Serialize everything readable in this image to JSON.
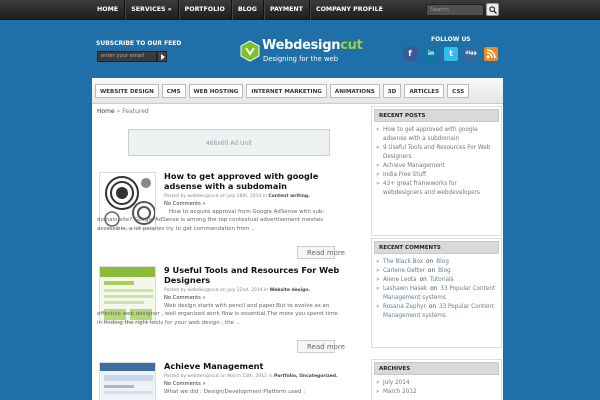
{
  "topnav": {
    "items": [
      "HOME",
      "SERVICES",
      "PORTFOLIO",
      "BLOG",
      "PAYMENT",
      "COMPANY PROFILE"
    ],
    "services_arrow": "»",
    "search_placeholder": "Search"
  },
  "header": {
    "subscribe_title": "SUBSCRIBE TO OUR FEED",
    "email_placeholder": "enter your email",
    "logo_main": "Webdesign",
    "logo_accent": "cut",
    "logo_sub": "Designing for the web",
    "follow_title": "FOLLOW US"
  },
  "categories": [
    "WEBSITE DESIGN",
    "CMS",
    "WEB HOSTING",
    "INTERNET MARKETING",
    "ANIMATIONS",
    "3D",
    "ARTICLES",
    "CSS"
  ],
  "breadcrumb": {
    "home": "Home",
    "sep": "»",
    "current": "Featured"
  },
  "ad": {
    "label": "468x60 Ad Unit"
  },
  "posts": [
    {
      "title": "How to get approved with google adsense with a subdomain",
      "meta_prefix": "Posted by webdesigncut on July 26th, 2014 in",
      "meta_cat": "Content writing.",
      "comments": "No Comments »",
      "excerpt": "How to acquire approval from Google AdSense with sub-domain site? Google AdSense is among the top contextual advertisement meshes accessible, a lot peoples try to get commendation from ..",
      "read_more": "Read more"
    },
    {
      "title": "9 Useful Tools and Resources For Web Designers",
      "meta_prefix": "Posted by webdesigncut on July 22nd, 2014 in",
      "meta_cat": "Website design.",
      "comments": "No Comments »",
      "excerpt": "Web design starts with pencil and paper.But to evolve as an effective web designer , well organized work flow is essential.The more you spend time in finding the right tools for your web design , the ..",
      "read_more": "Read more"
    },
    {
      "title": "Achieve Management",
      "meta_prefix": "Posted by webdesigncut on March 12th, 2012 in",
      "meta_cat": "Portfolio, Uncategorized.",
      "comments": "No Comments »",
      "excerpt": "What we did : Design/Development Platform used :",
      "read_more": ""
    }
  ],
  "sidebar": {
    "recent_posts_title": "RECENT POSTS",
    "recent_posts": [
      "How to get approved with google adsense with a subdomain",
      "9 Useful Tools and Resources For Web Designers",
      "Achieve Management",
      "India Free Stuff",
      "43+ great frameworks for webdesigners and webdevelopers"
    ],
    "recent_comments_title": "RECENT COMMENTS",
    "comment_on": "on",
    "recent_comments": [
      {
        "author": "The Black Box",
        "post": "Blog"
      },
      {
        "author": "Carlene Getter",
        "post": "Blog"
      },
      {
        "author": "Alene Leota",
        "post": "Tutorials"
      },
      {
        "author": "Lashawn Hasek",
        "post": "33 Popular Content Management systems"
      },
      {
        "author": "Rosana Zephyr",
        "post": "33 Popular Content Management systems"
      }
    ],
    "archives_title": "ARCHIVES",
    "archives": [
      "July 2014",
      "March 2012"
    ]
  }
}
